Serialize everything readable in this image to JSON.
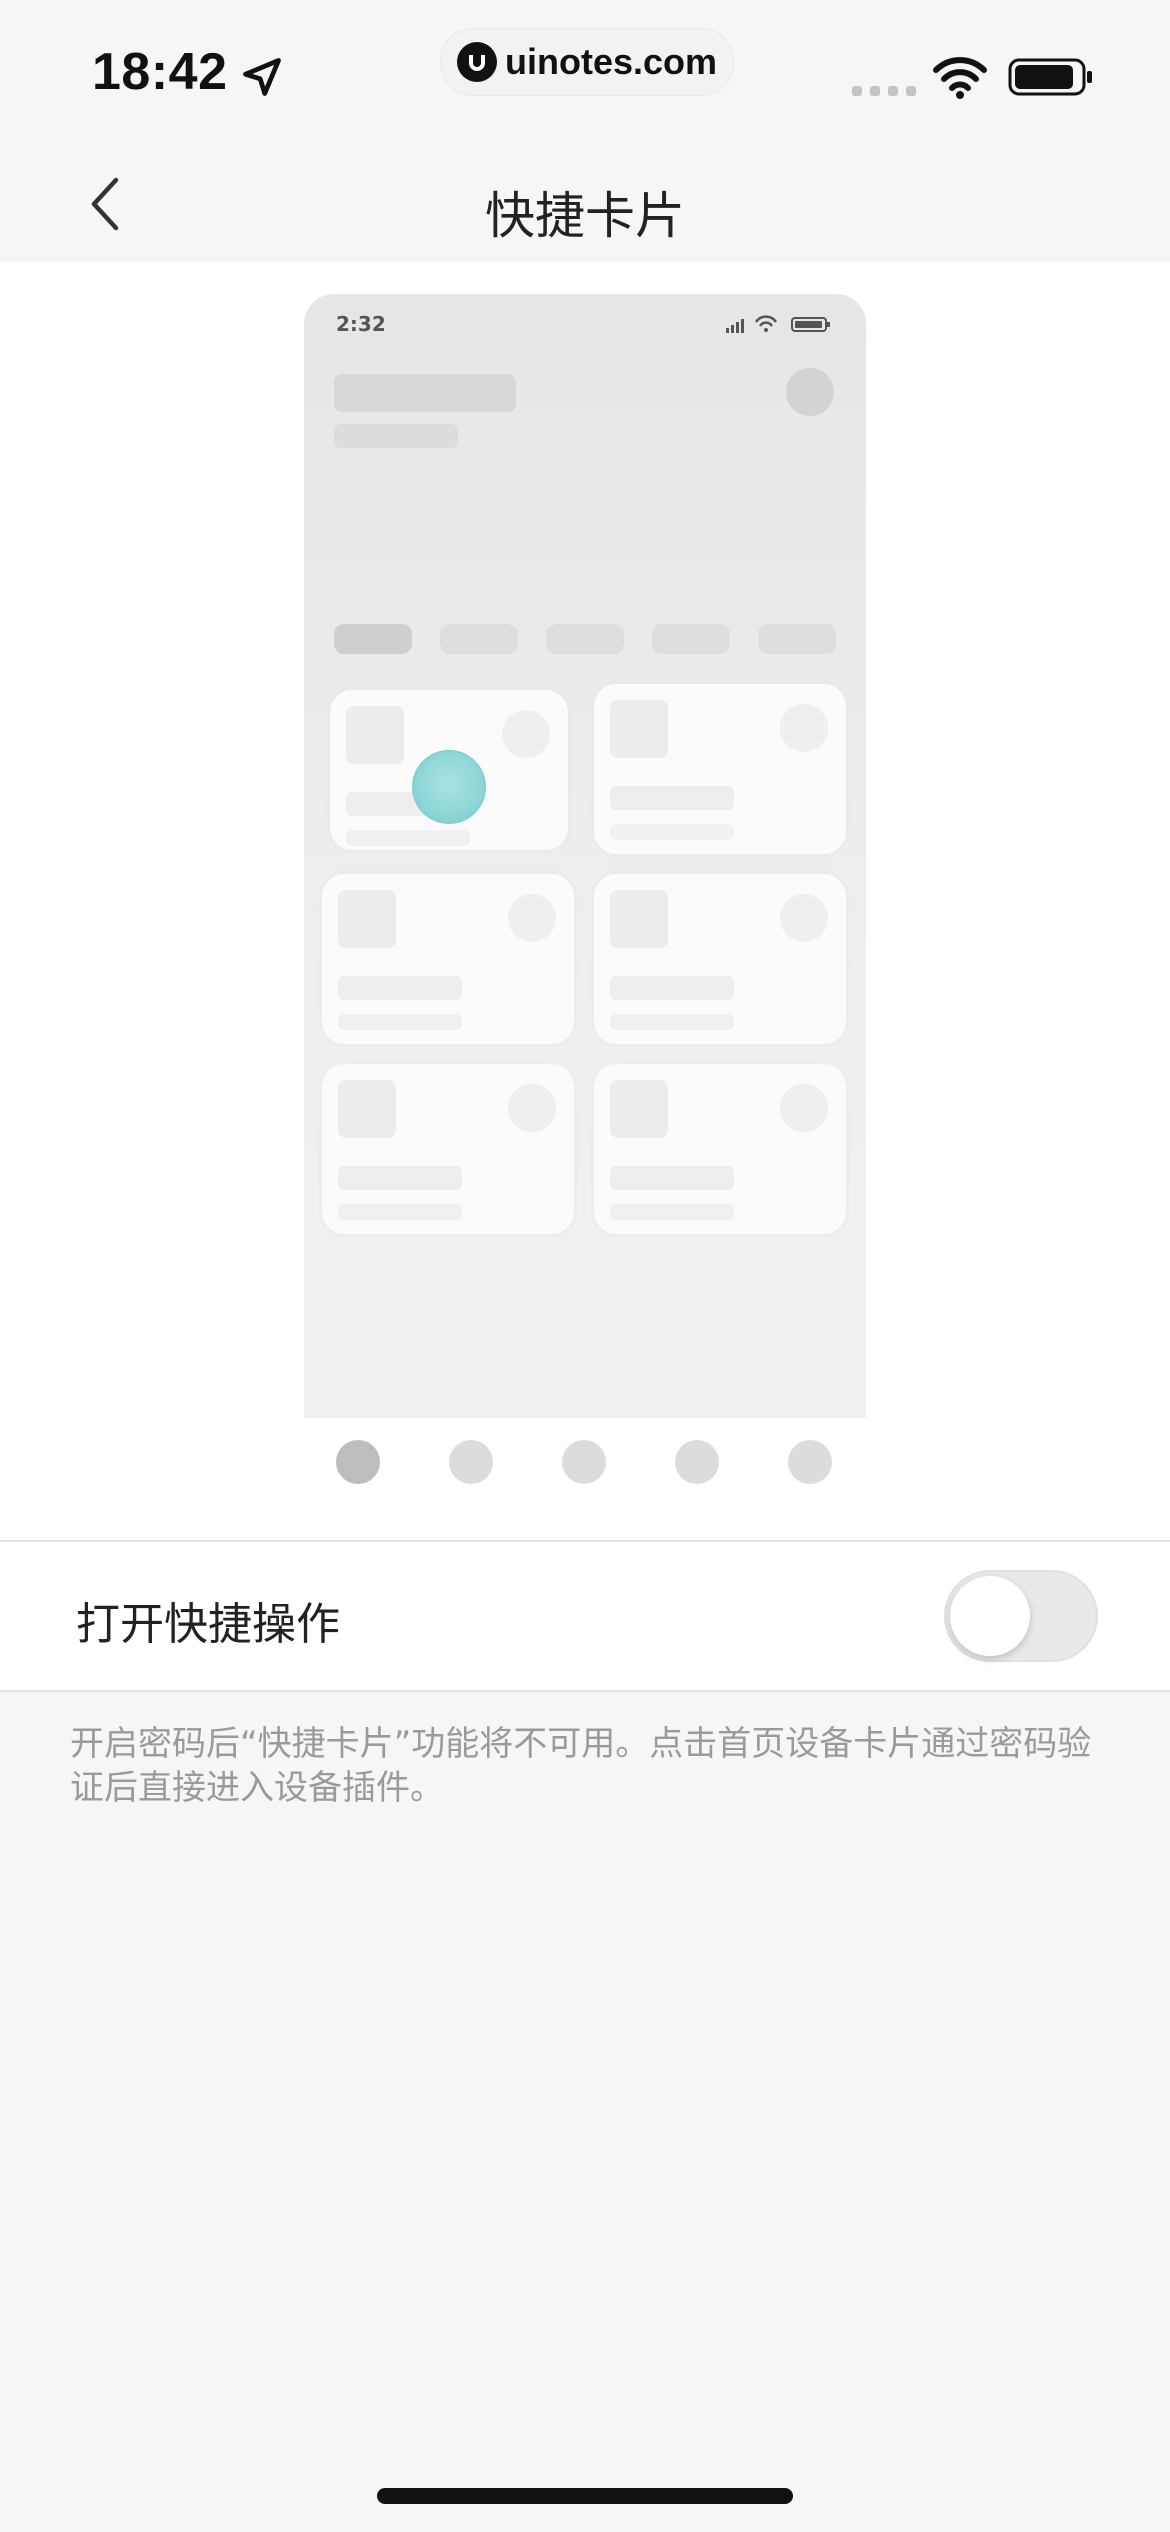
{
  "status_bar": {
    "time": "18:42",
    "url": "uinotes.com",
    "icons": [
      "location-arrow-icon",
      "uinotes-logo-icon",
      "signal-dots-icon",
      "wifi-icon",
      "battery-icon"
    ]
  },
  "nav": {
    "title": "快捷卡片",
    "back_icon": "chevron-left-icon"
  },
  "preview": {
    "time": "2:32",
    "touch_color": "#8fd6d8"
  },
  "pager": {
    "count": 5,
    "active_index": 0
  },
  "settings": {
    "quick_action_label": "打开快捷操作",
    "quick_action_enabled": false
  },
  "description": "开启密码后“快捷卡片”功能将不可用。点击首页设备卡片通过密码验证后直接进入设备插件。"
}
